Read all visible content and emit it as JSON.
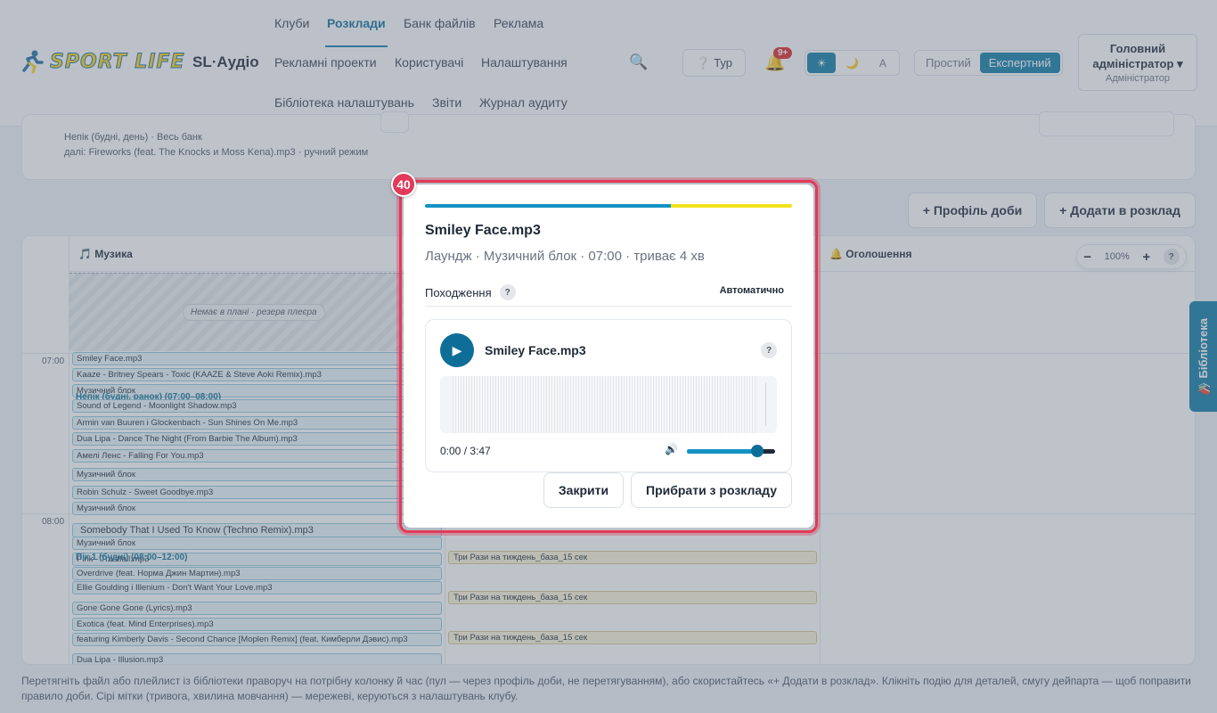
{
  "header": {
    "brand": "SL·Аудіо",
    "logo_text": "SPORT LIFE",
    "nav": {
      "clubs": "Клуби",
      "schedules": "Розклади",
      "file_bank": "Банк файлів",
      "ads": "Реклама",
      "ad_projects": "Рекламні проекти",
      "users": "Користувачі",
      "settings": "Налаштування",
      "settings_library": "Бібліотека налаштувань",
      "reports": "Звіти",
      "audit_log": "Журнал аудиту"
    },
    "tour_label": "Тур",
    "notifications_badge": "9+",
    "theme": {
      "light": "☀",
      "dark": "🌙",
      "auto": "A",
      "selected": "light"
    },
    "mode": {
      "simple": "Простий",
      "expert": "Експертний",
      "selected": "expert"
    },
    "admin": {
      "name": "Головний адміністратор",
      "caret": "▾",
      "role": "Адміністратор"
    }
  },
  "info_card": {
    "line1": "Непік (будні, день) · Весь банк",
    "line2": "далі: Fireworks (feat. The Knocks и Moss Kena).mp3 · ручний режим"
  },
  "actions": {
    "add_day_profile": "+ Профіль доби",
    "add_to_schedule": "+ Додати в розклад"
  },
  "grid": {
    "columns": {
      "music": "🎵 Музика",
      "announcements": "🔔 Оголошення"
    },
    "times": [
      "07:00",
      "08:00"
    ],
    "reserve_label": "Немає в плані · резерв плеєра",
    "zoom": {
      "minus": "−",
      "level": "100%",
      "plus": "+",
      "help": "?"
    },
    "band_labels": {
      "morning": "Непік (будні, ранок) (07:00–08:00)",
      "peak": "Пік 1 (будні) (08:00–12:00)"
    },
    "tracks": [
      "Smiley Face.mp3",
      "Kaaze - Britney Spears - Toxic (KAAZE & Steve Aoki Remix).mp3",
      "Музичний блок",
      "Sound of Legend - Moonlight Shadow.mp3",
      "Armin van Buuren і Glockenbach - Sun Shines On Me.mp3",
      "Dua Lipa - Dance The Night (From Barbie The Album).mp3",
      "Амелі Ленс - Falling For You.mp3",
      "Музичний блок",
      "Robin Schulz - Sweet Goodbye.mp3",
      "Музичний блок",
      "Somebody That I Used To Know (Techno Remix).mp3",
      "Музичний блок",
      "Pink - Trustfall.mp3",
      "Overdrive (feat. Норма Джин Мартин).mp3",
      "Ellie Goulding і Illenium - Don't Want Your Love.mp3",
      "Gone Gone Gone (Lyrics).mp3",
      "Exotica (feat. Mind Enterprises).mp3",
      "featuring Kimberly Davis - Second Chance [Moplen Remix] (feat. Кимберли Дэвис).mp3",
      "Dua Lipa - Illusion.mp3"
    ],
    "announcements": [
      "Три Рази на тиждень_база_15 сек",
      "Три Рази на тиждень_база_15 сек",
      "Три Рази на тиждень_база_15 сек"
    ]
  },
  "library_tab": "📚 Бібліотека",
  "footnote": "Перетягніть файл або плейлист із бібліотеки праворуч на потрібну колонку й час (пул — через профіль доби, не перетягуванням), або скористайтесь «+ Додати в розклад». Клікніть подію для деталей, смугу дейпарта — щоб поправити правило доби. Сірі мітки (тривога, хвилина мовчання) — мережеві, керуються з налаштувань клубу.",
  "modal": {
    "step_number": "40",
    "title": "Smiley Face.mp3",
    "subtitle": "Лаундж · Музичний блок · 07:00 · триває 4 хв",
    "origin_label": "Походження",
    "origin_value": "Автоматично",
    "help": "?",
    "player": {
      "play_icon": "▶",
      "title": "Smiley Face.mp3",
      "time": "0:00 / 3:47",
      "volume_icon": "🔊",
      "volume": 0.8
    },
    "close_label": "Закрити",
    "remove_label": "Прибрати з розкладу"
  },
  "colors": {
    "accent": "#0e7aa5",
    "highlight": "#e23a5a",
    "stripe_yellow": "#f2e21a"
  }
}
